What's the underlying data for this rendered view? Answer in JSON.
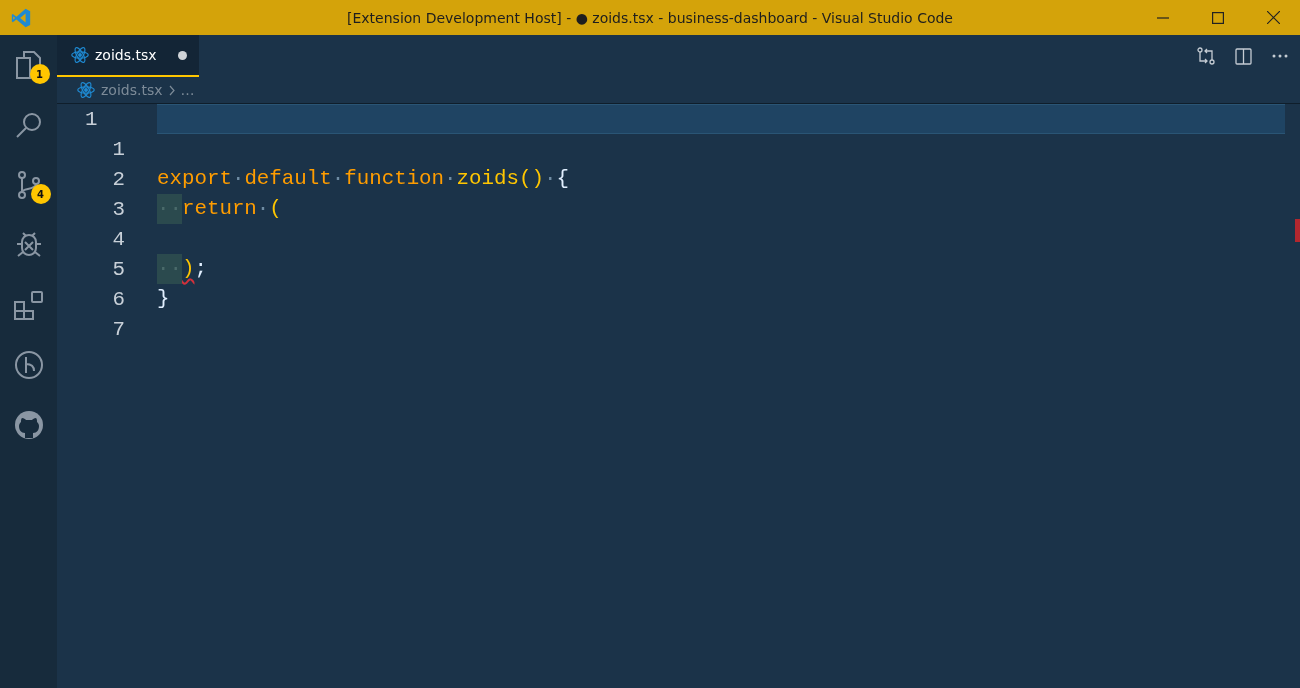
{
  "window": {
    "title": "[Extension Development Host] - ● zoids.tsx - business-dashboard - Visual Studio Code"
  },
  "activity_bar": [
    {
      "kind": "files",
      "badge": "1"
    },
    {
      "kind": "search"
    },
    {
      "kind": "source-control",
      "badge": "4"
    },
    {
      "kind": "debug"
    },
    {
      "kind": "extensions"
    },
    {
      "kind": "history"
    },
    {
      "kind": "github"
    }
  ],
  "tabs": [
    {
      "label": "zoids.tsx",
      "modified": true,
      "selected": true
    }
  ],
  "breadcrumb": {
    "file": "zoids.tsx",
    "more": "…"
  },
  "zone_line": "1",
  "lines": [
    {
      "number": "1"
    },
    {
      "number": "2",
      "tokens": [
        {
          "kind": "keyword",
          "text": "export"
        },
        {
          "kind": "space",
          "text": "·"
        },
        {
          "kind": "keyword",
          "text": "default"
        },
        {
          "kind": "space",
          "text": "·"
        },
        {
          "kind": "keyword",
          "text": "function"
        },
        {
          "kind": "space",
          "text": "·"
        },
        {
          "kind": "name",
          "text": "zoids()"
        },
        {
          "kind": "space",
          "text": "·"
        },
        {
          "kind": "punct",
          "text": "{"
        }
      ]
    },
    {
      "number": "3",
      "tokens": [
        {
          "kind": "indent",
          "text": "··"
        },
        {
          "kind": "keyword",
          "text": "return"
        },
        {
          "kind": "space",
          "text": "·"
        },
        {
          "kind": "name",
          "text": "("
        }
      ]
    },
    {
      "number": "4"
    },
    {
      "number": "5",
      "tokens": [
        {
          "kind": "indent",
          "text": "··"
        },
        {
          "kind": "error",
          "text": ")"
        },
        {
          "kind": "punct",
          "text": ";"
        }
      ]
    },
    {
      "number": "6",
      "tokens": [
        {
          "kind": "punct",
          "text": "}"
        }
      ]
    },
    {
      "number": "7"
    }
  ]
}
